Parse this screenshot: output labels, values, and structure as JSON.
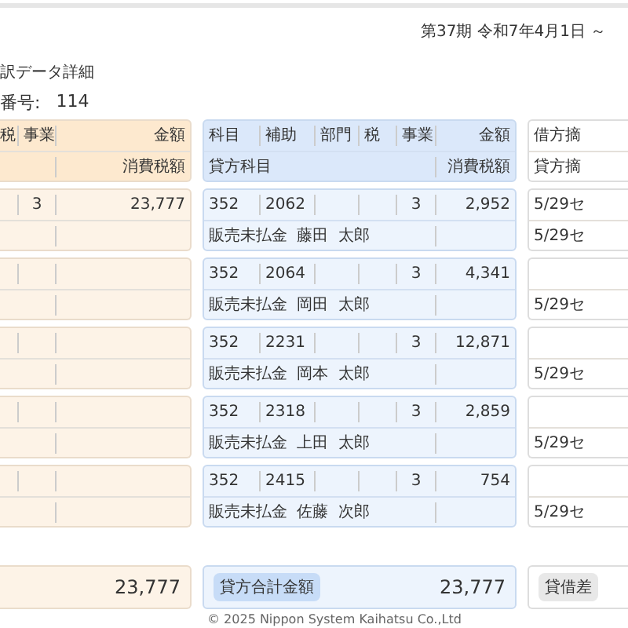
{
  "header": {
    "period": "第37期 令和7年4月1日 ～",
    "title": "訳データ詳細",
    "slip_label": "番号:",
    "slip_number": "114"
  },
  "debit_header": {
    "tax": "税",
    "business": "事業",
    "amount": "金額",
    "tax_amount": "消費税額"
  },
  "credit_header": {
    "account": "科目",
    "sub": "補助",
    "dept": "部門",
    "tax": "税",
    "business": "事業",
    "amount": "金額",
    "account_name": "貸方科目",
    "tax_amount": "消費税額"
  },
  "memo_header": {
    "debit": "借方摘",
    "credit": "貸方摘"
  },
  "entries": [
    {
      "debit": {
        "business": "3",
        "amount": "23,777"
      },
      "credit": {
        "account": "352",
        "sub": "2062",
        "business": "3",
        "amount": "2,952",
        "name": "販売未払金 藤田 太郎"
      },
      "memo": {
        "debit": "5/29セ",
        "credit": "5/29セ"
      }
    },
    {
      "credit": {
        "account": "352",
        "sub": "2064",
        "business": "3",
        "amount": "4,341",
        "name": "販売未払金 岡田 太郎"
      },
      "memo": {
        "credit": "5/29セ"
      }
    },
    {
      "credit": {
        "account": "352",
        "sub": "2231",
        "business": "3",
        "amount": "12,871",
        "name": "販売未払金 岡本 太郎"
      },
      "memo": {
        "credit": "5/29セ"
      }
    },
    {
      "credit": {
        "account": "352",
        "sub": "2318",
        "business": "3",
        "amount": "2,859",
        "name": "販売未払金 上田 太郎"
      },
      "memo": {
        "credit": "5/29セ"
      }
    },
    {
      "credit": {
        "account": "352",
        "sub": "2415",
        "business": "3",
        "amount": "754",
        "name": "販売未払金 佐藤 次郎"
      },
      "memo": {
        "credit": "5/29セ"
      }
    }
  ],
  "totals": {
    "debit_amount": "23,777",
    "credit_label": "貸方合計金額",
    "credit_amount": "23,777",
    "diff_label": "貸借差"
  },
  "copyright": "© 2025 Nippon System Kaihatsu Co.,Ltd"
}
